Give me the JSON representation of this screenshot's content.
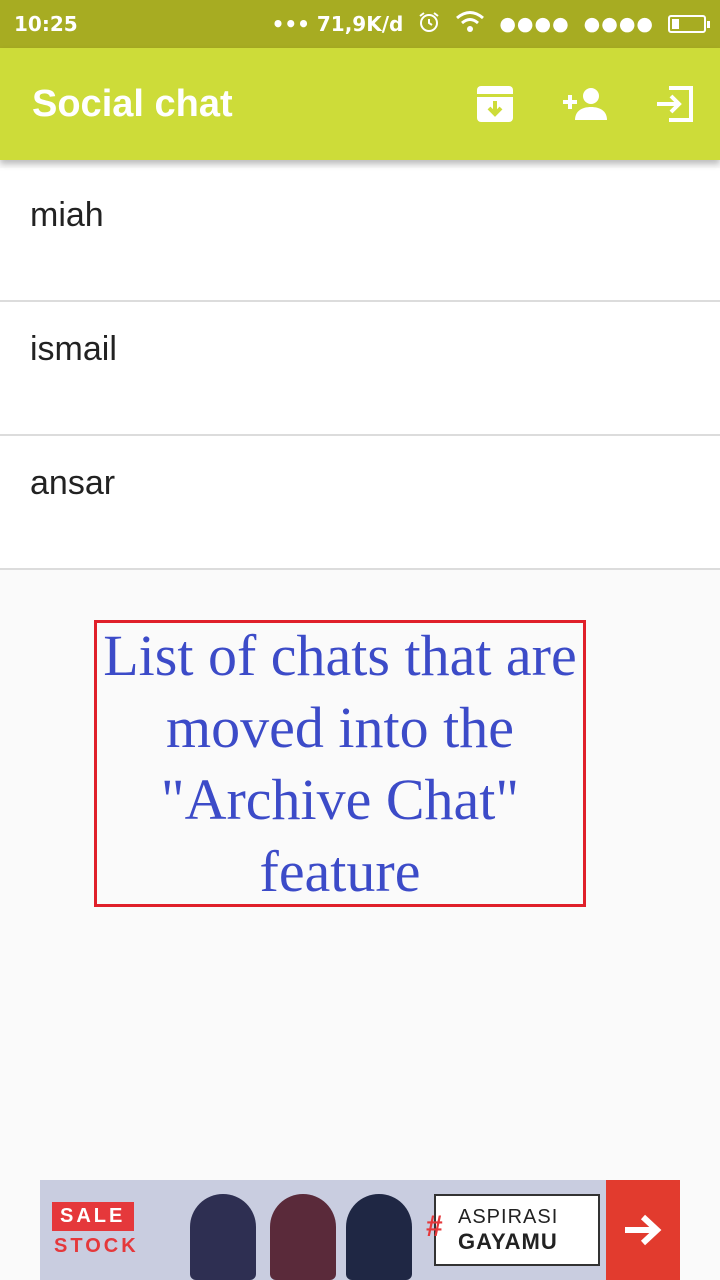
{
  "status_bar": {
    "time": "10:25",
    "network_speed": "••• 71,9K/d",
    "signal1": "●●●●",
    "signal2": "●●●●"
  },
  "app_bar": {
    "title": "Social chat",
    "actions": [
      {
        "icon": "archive-icon"
      },
      {
        "icon": "person-add-icon"
      },
      {
        "icon": "exit-icon"
      }
    ]
  },
  "chats": [
    {
      "name": "miah"
    },
    {
      "name": "ismail"
    },
    {
      "name": "ansar"
    }
  ],
  "annotation": {
    "text": "List of chats that are moved into the \"Archive Chat\" feature"
  },
  "ad": {
    "sale": "SALE",
    "stock": "STOCK",
    "hash": "#",
    "line1": "ASPIRASI",
    "line2": "GAYAMU"
  },
  "colors": {
    "status_bar": "#a7ac22",
    "app_bar": "#cddc39",
    "annotation_text": "#3c4bc8",
    "annotation_border": "#e0202a",
    "ad_accent": "#e23b2e"
  }
}
